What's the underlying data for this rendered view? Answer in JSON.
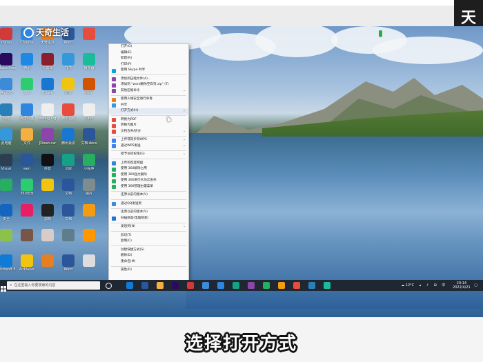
{
  "bezel": {
    "corner_text": "天"
  },
  "watermark": {
    "text": "天奇生活"
  },
  "desktop": {
    "icons": [
      {
        "label": "zhiliao",
        "color": "#d23a3a"
      },
      {
        "label": "Chrome",
        "color": "#2e86de"
      },
      {
        "label": "天奇生活",
        "color": "#e67e22"
      },
      {
        "label": "Word",
        "color": "#2b579a"
      },
      {
        "label": "",
        "color": "#e74c3c"
      },
      {
        "label": "Adobe Premiere",
        "color": "#2a0a5e"
      },
      {
        "label": "腾讯",
        "color": "#1e88e5"
      },
      {
        "label": "云剪辑",
        "color": "#8b1e2d"
      },
      {
        "label": "飞书",
        "color": "#3498db"
      },
      {
        "label": "播放器",
        "color": "#1abc9c"
      },
      {
        "label": "腾讯QQ",
        "color": "#3d8ad8"
      },
      {
        "label": "360",
        "color": "#2ecc71"
      },
      {
        "label": "JDown",
        "color": "#1976d2"
      },
      {
        "label": "迅雷",
        "color": "#f1c40f"
      },
      {
        "label": "图片",
        "color": "#d35400"
      },
      {
        "label": "网络",
        "color": "#2980b9"
      },
      {
        "label": "百度网盘",
        "color": "#2e86de"
      },
      {
        "label": "debug.log",
        "color": "#eeeeee"
      },
      {
        "label": "腾讯视频",
        "color": "#e74c3c"
      },
      {
        "label": "1.txt",
        "color": "#eeeeee"
      },
      {
        "label": "此电脑",
        "color": "#3498db"
      },
      {
        "label": "文件",
        "color": "#f5b041"
      },
      {
        "label": "JDown.rar",
        "color": "#8e44ad"
      },
      {
        "label": "腾讯会议",
        "color": "#1976d2"
      },
      {
        "label": "文档.docx",
        "color": "#2b579a"
      },
      {
        "label": "Visual",
        "color": "#2c3e50"
      },
      {
        "label": "wen",
        "color": "#2b579a"
      },
      {
        "label": "抖音",
        "color": "#111111"
      },
      {
        "label": "灵犀",
        "color": "#16a085"
      },
      {
        "label": "小程序",
        "color": "#27ae60"
      },
      {
        "label": "",
        "color": "#27ae60"
      },
      {
        "label": "360安全",
        "color": "#2ecc71"
      },
      {
        "label": "",
        "color": "#f1c40f"
      },
      {
        "label": "文档",
        "color": "#2b579a"
      },
      {
        "label": "图片",
        "color": "#7f8c8d"
      },
      {
        "label": "安全",
        "color": "#1565c0"
      },
      {
        "label": "",
        "color": "#e91e63"
      },
      {
        "label": "剪映",
        "color": "#222222"
      },
      {
        "label": "文档",
        "color": "#2b579a"
      },
      {
        "label": "",
        "color": "#f39c12"
      },
      {
        "label": "",
        "color": "#8bc34a"
      },
      {
        "label": "",
        "color": "#795548"
      },
      {
        "label": "",
        "color": "#d7ccc8"
      },
      {
        "label": "",
        "color": "#607d8b"
      },
      {
        "label": "",
        "color": "#ff9800"
      },
      {
        "label": "Microsoft Edge",
        "color": "#0f7bd6"
      },
      {
        "label": "AirPlayer",
        "color": "#f1c40f"
      },
      {
        "label": "",
        "color": "#e67e22"
      },
      {
        "label": "Word",
        "color": "#2b579a"
      },
      {
        "label": "",
        "color": "#dddddd"
      }
    ]
  },
  "context_menu": {
    "items": [
      {
        "type": "item",
        "label": "打开(O)",
        "icon": "",
        "color": ""
      },
      {
        "type": "item",
        "label": "编辑(E)",
        "icon": "",
        "color": ""
      },
      {
        "type": "item",
        "label": "新建(N)",
        "icon": "",
        "color": ""
      },
      {
        "type": "item",
        "label": "打印(P)",
        "icon": "",
        "color": ""
      },
      {
        "type": "item",
        "label": "使用 Skype 共享",
        "icon": "skype-icon",
        "color": "#0aa3e0"
      },
      {
        "type": "sep"
      },
      {
        "type": "item",
        "label": "添加到压缩文件(A)...",
        "icon": "archive-icon",
        "color": "#8e44ad"
      },
      {
        "type": "item",
        "label": "添加到 \"word删除空白页.zip\" (T)",
        "icon": "archive-icon",
        "color": "#8e44ad"
      },
      {
        "type": "item",
        "label": "其他压缩命令",
        "icon": "archive-icon",
        "color": "#8e44ad",
        "arrow": "›"
      },
      {
        "type": "sep"
      },
      {
        "type": "item",
        "label": "使用火绒安全进行杀毒",
        "icon": "shield-icon",
        "color": "#e67e22"
      },
      {
        "type": "item",
        "label": "共享",
        "icon": "share-icon",
        "color": "#3498db"
      },
      {
        "type": "item",
        "label": "打开方式(H)",
        "icon": "",
        "color": "",
        "arrow": "›",
        "highlight": true
      },
      {
        "type": "sep"
      },
      {
        "type": "item",
        "label": "转换为PDF",
        "icon": "pdf-icon",
        "color": "#e74c3c"
      },
      {
        "type": "item",
        "label": "转换为图片",
        "icon": "image-icon",
        "color": "#e74c3c"
      },
      {
        "type": "item",
        "label": "文档合并/拆分",
        "icon": "doc-icon",
        "color": "#e74c3c",
        "arrow": "›"
      },
      {
        "type": "sep"
      },
      {
        "type": "item",
        "label": "上传或同步到WPS",
        "icon": "cloud-icon",
        "color": "#3b82f6",
        "arrow": "›"
      },
      {
        "type": "item",
        "label": "通过WPS发送",
        "icon": "send-icon",
        "color": "#3b82f6",
        "arrow": "›"
      },
      {
        "type": "sep"
      },
      {
        "type": "item",
        "label": "授予访问权限(G)",
        "icon": "",
        "color": "",
        "arrow": "›"
      },
      {
        "type": "sep"
      },
      {
        "type": "item",
        "label": "上传到百度网盘",
        "icon": "baidu-icon",
        "color": "#2e86de"
      },
      {
        "type": "item",
        "label": "使用 360解除占用",
        "icon": "360-icon",
        "color": "#27ae60"
      },
      {
        "type": "item",
        "label": "使用 360强力删除",
        "icon": "360-icon",
        "color": "#27ae60"
      },
      {
        "type": "item",
        "label": "使用 360进行木马云查杀",
        "icon": "360-icon",
        "color": "#27ae60"
      },
      {
        "type": "item",
        "label": "使用 360管理右键菜单",
        "icon": "360-icon",
        "color": "#27ae60"
      },
      {
        "type": "sep"
      },
      {
        "type": "item",
        "label": "还原以前的版本(V)",
        "icon": "",
        "color": ""
      },
      {
        "type": "sep"
      },
      {
        "type": "item",
        "label": "通过QQ发送到",
        "icon": "qq-icon",
        "color": "#3d8ad8"
      },
      {
        "type": "sep"
      },
      {
        "type": "item",
        "label": "还原以前的版本(V)",
        "icon": "",
        "color": ""
      },
      {
        "type": "item",
        "label": "扫描病毒(电脑管家)",
        "icon": "shield-icon",
        "color": "#1976d2"
      },
      {
        "type": "sep"
      },
      {
        "type": "item",
        "label": "发送到(N)",
        "icon": "",
        "color": "",
        "arrow": "›"
      },
      {
        "type": "sep"
      },
      {
        "type": "item",
        "label": "剪切(T)",
        "icon": "",
        "color": ""
      },
      {
        "type": "item",
        "label": "复制(C)",
        "icon": "",
        "color": ""
      },
      {
        "type": "sep"
      },
      {
        "type": "item",
        "label": "创建快捷方式(S)",
        "icon": "",
        "color": ""
      },
      {
        "type": "item",
        "label": "删除(D)",
        "icon": "",
        "color": ""
      },
      {
        "type": "item",
        "label": "重命名(M)",
        "icon": "",
        "color": ""
      },
      {
        "type": "sep"
      },
      {
        "type": "item",
        "label": "属性(R)",
        "icon": "",
        "color": ""
      }
    ]
  },
  "taskbar": {
    "search_placeholder": "在这里输入你要搜索的内容",
    "apps": [
      {
        "name": "edge-icon",
        "color": "#0f7bd6"
      },
      {
        "name": "word-icon",
        "color": "#2b579a"
      },
      {
        "name": "explorer-icon",
        "color": "#f5b041"
      },
      {
        "name": "premiere-icon",
        "color": "#2a0a5e"
      },
      {
        "name": "wps-icon",
        "color": "#d23a3a"
      },
      {
        "name": "qq-icon",
        "color": "#3d8ad8"
      },
      {
        "name": "chrome-icon",
        "color": "#2e86de"
      },
      {
        "name": "app-icon",
        "color": "#16a085"
      },
      {
        "name": "app-icon",
        "color": "#8e44ad"
      },
      {
        "name": "app-icon",
        "color": "#27ae60"
      },
      {
        "name": "app-icon",
        "color": "#f39c12"
      },
      {
        "name": "app-icon",
        "color": "#e74c3c"
      },
      {
        "name": "app-icon",
        "color": "#2980b9"
      },
      {
        "name": "app-icon",
        "color": "#1abc9c"
      }
    ],
    "weather": "12°C",
    "time": "20:14",
    "date": "2022/4/21"
  },
  "subtitle": "选择打开方式"
}
